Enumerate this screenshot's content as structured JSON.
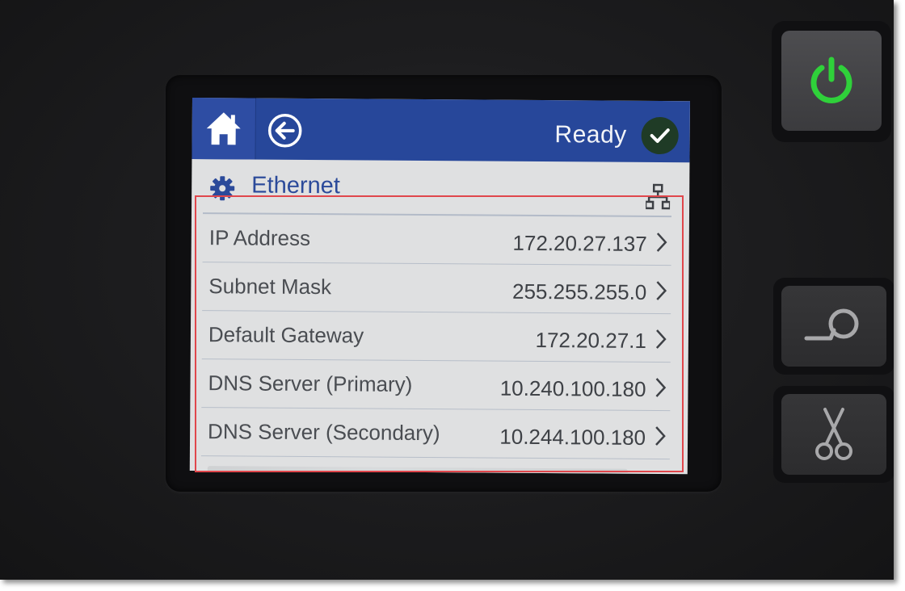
{
  "header": {
    "status": "Ready"
  },
  "section": {
    "title": "Ethernet"
  },
  "rows": [
    {
      "label": "IP Address",
      "value": "172.20.27.137"
    },
    {
      "label": "Subnet Mask",
      "value": "255.255.255.0"
    },
    {
      "label": "Default Gateway",
      "value": "172.20.27.1"
    },
    {
      "label": "DNS Server (Primary)",
      "value": "10.240.100.180"
    },
    {
      "label": "DNS Server (Secondary)",
      "value": "10.244.100.180"
    }
  ],
  "icons": {
    "home": "home-icon",
    "back": "back-arrow-icon",
    "status": "checkmark-icon",
    "section": "gear-icon",
    "network": "network-icon",
    "chevron": "chevron-right-icon",
    "power": "power-icon",
    "feed": "paper-feed-icon",
    "cut": "scissors-icon"
  },
  "colors": {
    "topbar": "#27479a",
    "title": "#2b4a9a",
    "status_badge": "#1f3b26",
    "power_led": "#2fd13a",
    "highlight_box": "#e0474c"
  }
}
